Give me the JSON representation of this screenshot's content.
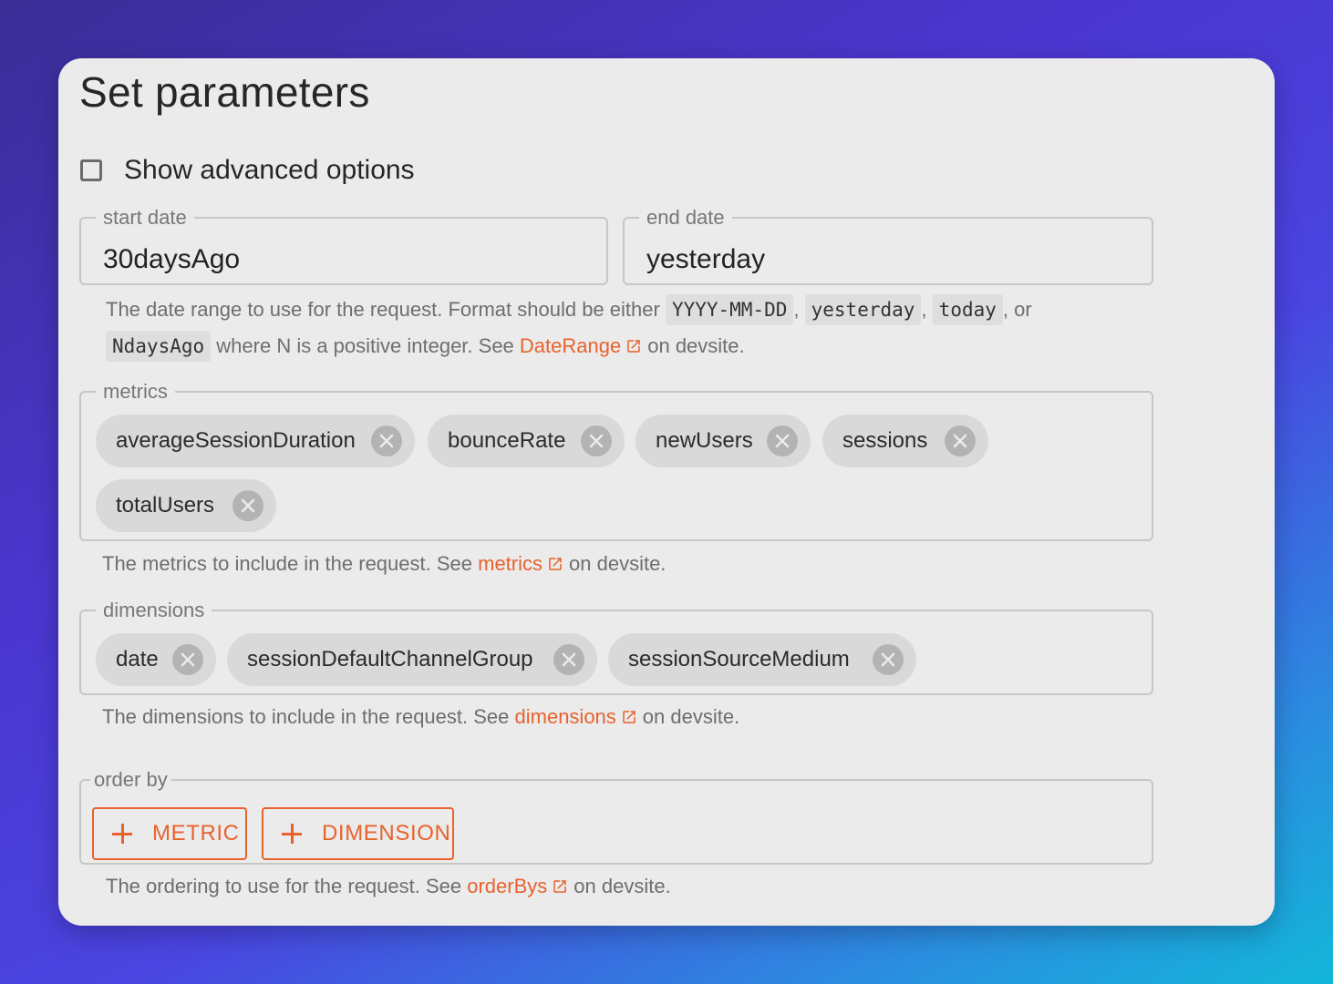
{
  "page": {
    "title": "Set parameters",
    "advanced_checkbox": {
      "label": "Show advanced options",
      "checked": false
    }
  },
  "dates": {
    "start": {
      "label": "start date",
      "value": "30daysAgo"
    },
    "end": {
      "label": "end date",
      "value": "yesterday"
    },
    "helper": {
      "prefix": "The date range to use for the request. Format should be either",
      "code1": "YYYY-MM-DD",
      "sep1": ",",
      "code2": "yesterday",
      "sep2": ",",
      "code3": "today",
      "sep3": ", or",
      "code4": "NdaysAgo",
      "middle": "where N is a positive integer. See",
      "link": "DateRange",
      "suffix": "on devsite."
    }
  },
  "metrics": {
    "label": "metrics",
    "chips": [
      "averageSessionDuration",
      "bounceRate",
      "newUsers",
      "sessions",
      "totalUsers"
    ],
    "helper": {
      "prefix": "The metrics to include in the request. See",
      "link": "metrics",
      "suffix": "on devsite."
    }
  },
  "dimensions": {
    "label": "dimensions",
    "chips": [
      "date",
      "sessionDefaultChannelGroup",
      "sessionSourceMedium"
    ],
    "helper": {
      "prefix": "The dimensions to include in the request. See",
      "link": "dimensions",
      "suffix": "on devsite."
    }
  },
  "order_by": {
    "label": "order by",
    "buttons": [
      "METRIC",
      "DIMENSION"
    ],
    "helper": {
      "prefix": "The ordering to use for the request. See",
      "link": "orderBys",
      "suffix": "on devsite."
    }
  },
  "colors": {
    "accent": "#e8622d",
    "card": "#ebebeb",
    "chip": "#d9d9d9"
  },
  "icons": {
    "checkbox": "checkbox-unchecked-icon",
    "chip_remove": "cancel-circle-icon",
    "external_link": "open-in-new-icon",
    "add": "plus-icon"
  }
}
